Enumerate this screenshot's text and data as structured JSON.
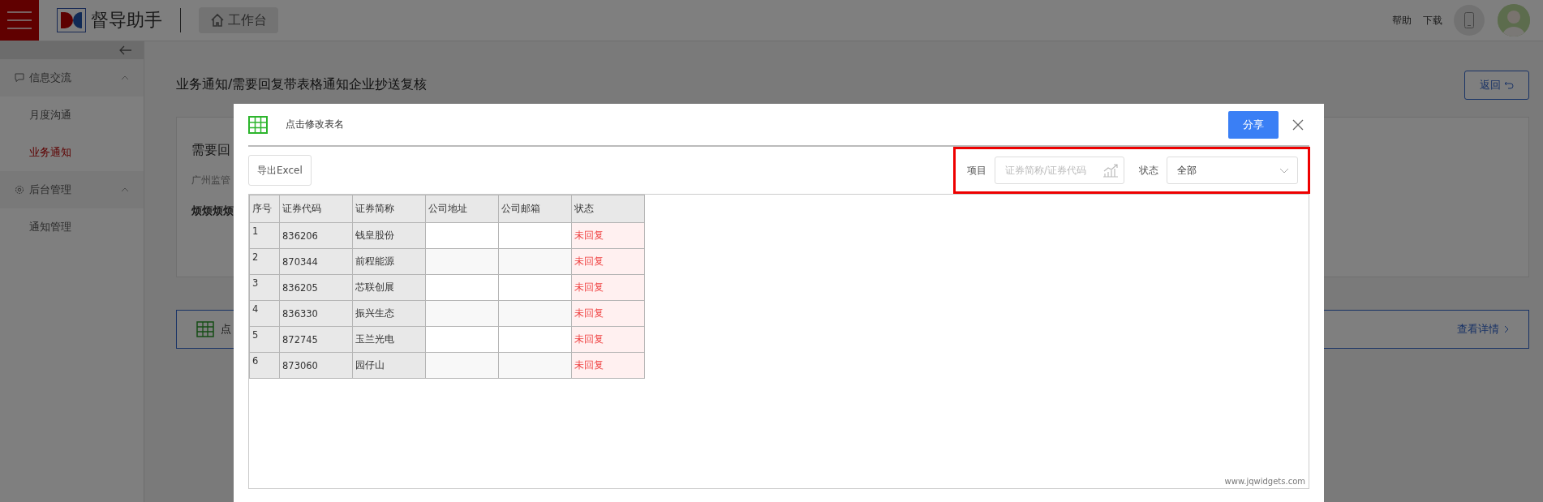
{
  "header": {
    "app_name": "督导助手",
    "home_tab": "工作台",
    "links": [
      "帮助",
      "下载"
    ]
  },
  "sidebar": {
    "groups": [
      {
        "label": "信息交流",
        "expanded": true,
        "items": [
          {
            "label": "月度沟通",
            "selected": false
          },
          {
            "label": "业务通知",
            "selected": true
          }
        ]
      },
      {
        "label": "后台管理",
        "expanded": true,
        "items": [
          {
            "label": "通知管理",
            "selected": false
          }
        ]
      }
    ]
  },
  "page": {
    "title": "业务通知/需要回复带表格通知企业抄送复核",
    "back_button": "返回",
    "card": {
      "heading": "需要回",
      "meta": "广州监管",
      "body": "烦烦烦烦"
    },
    "attachment": {
      "name": "点",
      "link": "查看详情"
    }
  },
  "dialog": {
    "table_name": "点击修改表名",
    "share_button": "分享",
    "export_button": "导出Excel",
    "filters": {
      "project_label": "项目",
      "project_placeholder": "证券简称/证券代码",
      "status_label": "状态",
      "status_value": "全部"
    },
    "table": {
      "columns": [
        "序号",
        "证券代码",
        "证券简称",
        "公司地址",
        "公司邮箱",
        "状态"
      ],
      "rows": [
        {
          "no": "1",
          "code": "836206",
          "name": "钱皇股份",
          "status": "未回复"
        },
        {
          "no": "2",
          "code": "870344",
          "name": "前程能源",
          "status": "未回复"
        },
        {
          "no": "3",
          "code": "836205",
          "name": "芯联创展",
          "status": "未回复"
        },
        {
          "no": "4",
          "code": "836330",
          "name": "振兴生态",
          "status": "未回复"
        },
        {
          "no": "5",
          "code": "872745",
          "name": "玉兰光电",
          "status": "未回复"
        },
        {
          "no": "6",
          "code": "873060",
          "name": "园仔山",
          "status": "未回复"
        }
      ]
    },
    "footer": "www.jqwidgets.com"
  }
}
